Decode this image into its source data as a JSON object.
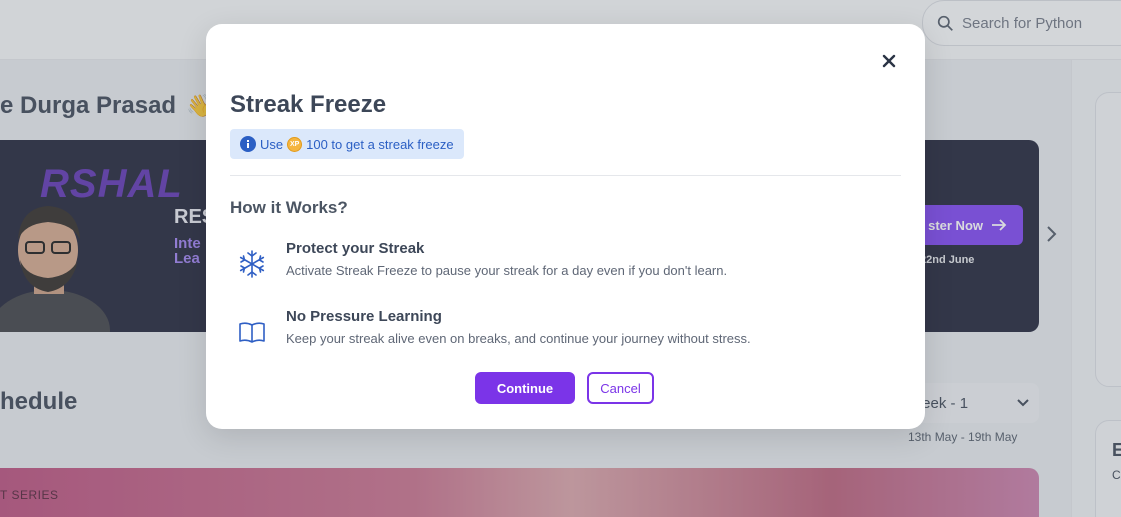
{
  "background": {
    "search": {
      "placeholder": "Search for Python",
      "icon": "search-icon"
    },
    "greeting": {
      "text": "e Durga Prasad",
      "emoji": "👋"
    },
    "banner": {
      "brand": "RSHAL",
      "heading": "RES",
      "subline1": "Inte",
      "subline2": "Lea",
      "register_label": "ster Now",
      "date": "22nd June"
    },
    "schedule": {
      "title": "hedule",
      "week_label": "Veek - 1",
      "range": "13th May - 19th May"
    },
    "series_label": "T SERIES",
    "side_card": {
      "title": "E",
      "sub": "C"
    }
  },
  "modal": {
    "title": "Streak Freeze",
    "info": {
      "prefix": "Use",
      "amount": "100 to get a streak freeze",
      "coin_text": "XP"
    },
    "how_title": "How it Works?",
    "features": [
      {
        "icon": "snowflake-icon",
        "title": "Protect your Streak",
        "desc": "Activate Streak Freeze to pause your streak for a day even if you don't learn."
      },
      {
        "icon": "book-open-icon",
        "title": "No Pressure Learning",
        "desc": "Keep your streak alive even on breaks, and continue your journey without stress."
      }
    ],
    "buttons": {
      "continue": "Continue",
      "cancel": "Cancel"
    }
  },
  "colors": {
    "accent": "#7b34e8",
    "info_bg": "#dbe8fb",
    "info_text": "#2b5fc4",
    "icon_blue": "#2f5fc4"
  }
}
